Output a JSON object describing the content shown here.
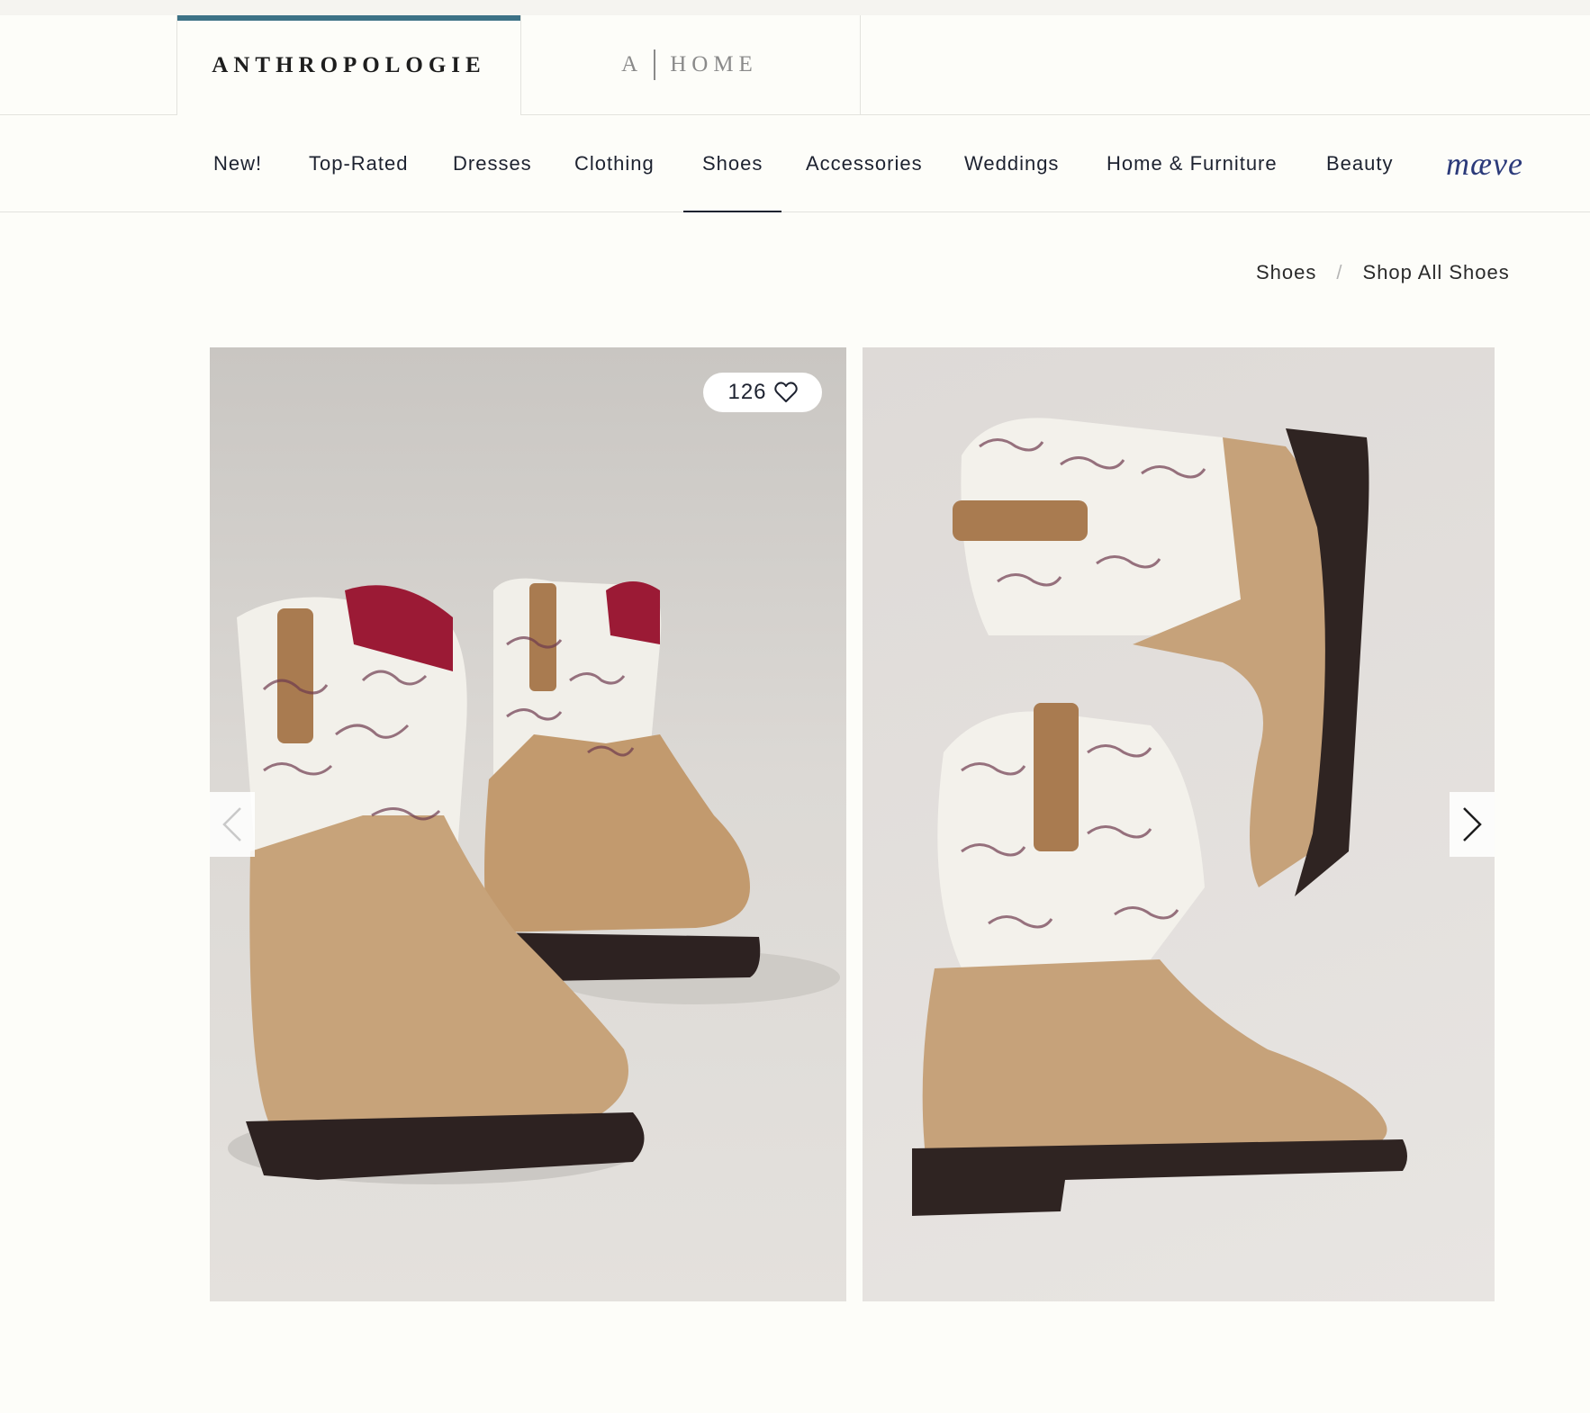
{
  "brands": {
    "anthropologie": "ANTHROPOLOGIE",
    "home_a": "A",
    "home_word": "HOME"
  },
  "nav": {
    "items": [
      "New!",
      "Top-Rated",
      "Dresses",
      "Clothing",
      "Shoes",
      "Accessories",
      "Weddings",
      "Home & Furniture",
      "Beauty"
    ],
    "active": "Shoes",
    "maeve": "mæve"
  },
  "breadcrumb": {
    "items": [
      "Shoes",
      "Shop All Shoes"
    ],
    "separator": "/"
  },
  "gallery": {
    "like_count": "126",
    "images": [
      {
        "alt": "Western boots with horse print shafts, angled view"
      },
      {
        "alt": "Western boots with horse print shafts, side view"
      }
    ],
    "icons": {
      "like": "heart-icon",
      "prev": "chevron-left-icon",
      "next": "chevron-right-icon"
    }
  },
  "colors": {
    "accent": "#3d7286",
    "text": "#1d2230",
    "maeve": "#2b3a7a",
    "background": "#fdfdf9"
  }
}
